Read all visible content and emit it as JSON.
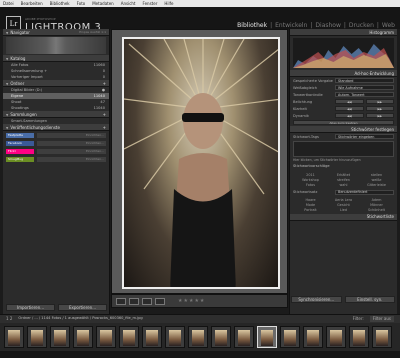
{
  "menubar": [
    "Datei",
    "Bearbeiten",
    "Bibliothek",
    "Foto",
    "Metadaten",
    "Ansicht",
    "Fenster",
    "Hilfe"
  ],
  "app": {
    "logo": "Lr",
    "subtitle": "ADOBE PHOTOSHOP",
    "title": "LIGHTROOM 3"
  },
  "modules": [
    "Bibliothek",
    "Entwickeln",
    "Diashow",
    "Drucken",
    "Web"
  ],
  "left": {
    "navigator": {
      "title": "Navigator",
      "opts": "Einpas  Ausfüll  1:1"
    },
    "katalog": {
      "title": "Katalog",
      "items": [
        {
          "label": "Alle Fotos",
          "count": "11060"
        },
        {
          "label": "Schnellsammlung +",
          "count": "0"
        },
        {
          "label": "Vorheriger Import",
          "count": "0"
        }
      ]
    },
    "ordner": {
      "title": "Ordner",
      "drive": "Digital Bilder (D:)",
      "items": [
        {
          "label": "Eigene",
          "count": "11040"
        },
        {
          "label": "Shoot",
          "count": "47"
        },
        {
          "label": "Shootings",
          "count": "11040"
        }
      ]
    },
    "sammlungen": {
      "title": "Sammlungen",
      "items": [
        {
          "label": "Smart-Sammlungen",
          "count": ""
        }
      ]
    },
    "veroeff": {
      "title": "Veröffentlichungsdienste",
      "services": [
        {
          "name": "Festplatte",
          "color": "#4a6ea8",
          "action": "Einrichten..."
        },
        {
          "name": "Facebook",
          "color": "#3b5998",
          "action": "Einrichten..."
        },
        {
          "name": "Flickr",
          "color": "#ff0084",
          "action": "Einrichten..."
        },
        {
          "name": "SmugMug",
          "color": "#6b8e23",
          "action": "Einrichten..."
        }
      ]
    },
    "import_label": "Importieren...",
    "export_label": "Exportieren..."
  },
  "right": {
    "histogram": {
      "title": "Histogramm"
    },
    "quick_develop": {
      "title": "Ad-hoc-Entwicklung",
      "preset_label": "Gespeicherte Vorgabe",
      "preset_value": "Standard",
      "wb_label": "Weißabgleich",
      "wb_value": "Wie Aufnahme",
      "tone_label": "Tonwertkontrolle",
      "auto_tone": "Autom. Tonwert",
      "exposure": "Belichtung",
      "clarity": "Klarheit",
      "vibrance": "Dynamik",
      "reset": "Alles zurücksetzen"
    },
    "keywords": {
      "title": "Stichwörter festlegen",
      "tags_label": "Stichwort-Tags",
      "tags_value": "Stichwörter eingeben",
      "hint": "Hier klicken, um Stichwörter hinzuzufügen",
      "suggest_title": "Stichwortvorschläge",
      "suggestions": [
        "2011",
        "Erkältet",
        "stellen",
        "Workshop",
        "streifen",
        "weiße",
        "Fotos",
        "wahl",
        "Gitterleiste"
      ],
      "set_label": "Stichwortsatz",
      "set_value": "Benutzerdefiniert",
      "set_items": [
        "Haare",
        "Aeria Lera",
        "Adem",
        "Mode",
        "Gesicht",
        "Männer",
        "Portrait",
        "Lied",
        "Schönheit"
      ],
      "list_title": "Stichwortliste"
    },
    "sync_label": "Synchronisieren...",
    "sync_settings": "Einstell. syn."
  },
  "toolbar": {
    "stars": "★★★★★"
  },
  "filmbar": {
    "pages": "1  2",
    "path": "Ordner / ... / 1144 Fotos / 1 ausgewählt /  Posrocks_600360_file_m.jpg",
    "filter": "Filter:",
    "filter_value": "Filter aus"
  },
  "filmstrip": {
    "count": 17,
    "selected": 11
  }
}
